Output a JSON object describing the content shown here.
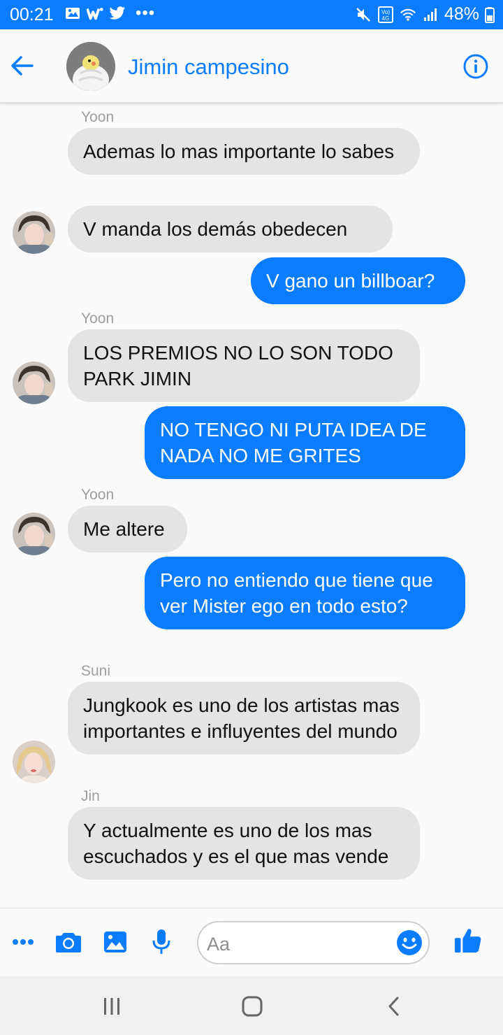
{
  "status_bar": {
    "time": "00:21",
    "battery": "48%",
    "left_icons": [
      "gallery-icon",
      "w-app-icon",
      "twitter-icon"
    ],
    "right_icons": [
      "mute-icon",
      "volte-4g-icon",
      "wifi-icon",
      "signal-icon",
      "battery-icon"
    ]
  },
  "header": {
    "title": "Jimin campesino",
    "back_icon": "arrow-left-icon",
    "info_icon": "info-icon"
  },
  "messages": [
    {
      "direction": "in",
      "sender": "Yoon",
      "text": "Ademas lo mas importante lo sabes"
    },
    {
      "direction": "in",
      "text": "V manda los demás obedecen",
      "avatar": "yoon"
    },
    {
      "direction": "out",
      "text": "V gano un billboar?"
    },
    {
      "direction": "in",
      "sender": "Yoon",
      "text": "LOS PREMIOS NO LO SON TODO PARK JIMIN",
      "avatar": "yoon"
    },
    {
      "direction": "out",
      "text": "NO TENGO NI PUTA IDEA DE NADA NO ME GRITES"
    },
    {
      "direction": "in",
      "sender": "Yoon",
      "text": "Me altere",
      "avatar": "yoon"
    },
    {
      "direction": "out",
      "text": "Pero no entiendo que tiene que ver Mister ego en todo esto?"
    },
    {
      "direction": "in",
      "sender": "Suni",
      "text": "Jungkook es uno de los artistas mas importantes e influyentes del mundo",
      "avatar": "suni"
    },
    {
      "direction": "in",
      "sender": "Jin",
      "text": "Y actualmente es uno de los mas escuchados y es el que mas vende"
    }
  ],
  "composer": {
    "placeholder": "Aa",
    "icons": [
      "more-icon",
      "camera-icon",
      "image-icon",
      "microphone-icon",
      "emoji-icon",
      "thumbs-up-icon"
    ]
  },
  "colors": {
    "accent": "#0a7cff",
    "incoming_bubble": "#e4e4e4",
    "background": "#fafafa"
  }
}
